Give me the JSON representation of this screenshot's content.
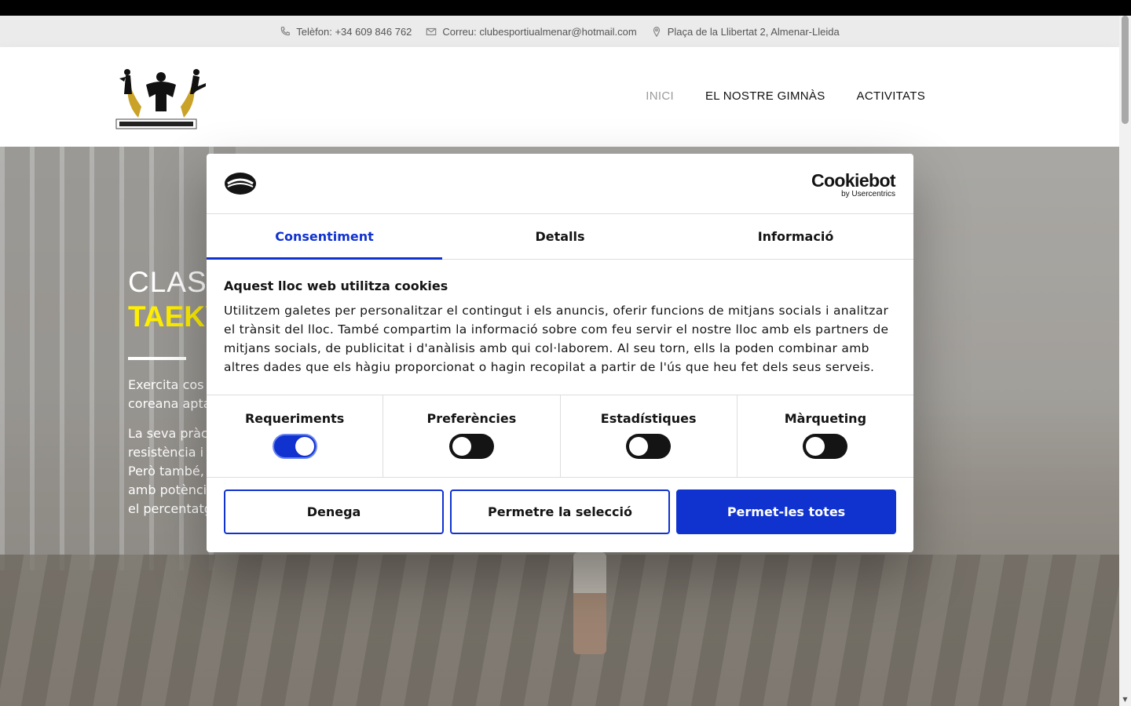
{
  "topbar": {
    "phone": "Telèfon: +34 609 846 762",
    "email": "Correu: clubesportiualmenar@hotmail.com",
    "address": "Plaça de la Llibertat 2, Almenar-Lleida"
  },
  "nav": {
    "items": [
      "INICI",
      "EL NOSTRE GIMNÀS",
      "ACTIVITATS"
    ]
  },
  "hero": {
    "line1": "CLASE",
    "line2": "TAEKY",
    "para1_a": "Exercita cos",
    "para1_b": "coreana apta",
    "para2_a": "La seva pràc",
    "para2_b": "resistència i",
    "para2_c": "Però també,",
    "para2_d": "amb potènci",
    "para2_e": "el percentatg"
  },
  "dialog": {
    "brand": "Cookiebot",
    "brand_sub": "by Usercentrics",
    "tabs": [
      "Consentiment",
      "Detalls",
      "Informació"
    ],
    "title": "Aquest lloc web utilitza cookies",
    "text": "Utilitzem galetes per personalitzar el contingut i els anuncis, oferir funcions de mitjans socials i analitzar el trànsit del lloc. També compartim la informació sobre com feu servir el nostre lloc amb els partners de mitjans socials, de publicitat i d'anàlisis amb qui col·laborem. Al seu torn, ells la poden combinar amb altres dades que els hàgiu proporcionat o hagin recopilat a partir de l'ús que heu fet dels seus serveis.",
    "toggles": [
      {
        "label": "Requeriments",
        "on": true
      },
      {
        "label": "Preferències",
        "on": false
      },
      {
        "label": "Estadístiques",
        "on": false
      },
      {
        "label": "Màrqueting",
        "on": false
      }
    ],
    "buttons": {
      "deny": "Denega",
      "allow_selection": "Permetre la selecció",
      "allow_all": "Permet-les totes"
    }
  },
  "colors": {
    "accent": "#1032cf",
    "hero_highlight": "#ffef00"
  }
}
